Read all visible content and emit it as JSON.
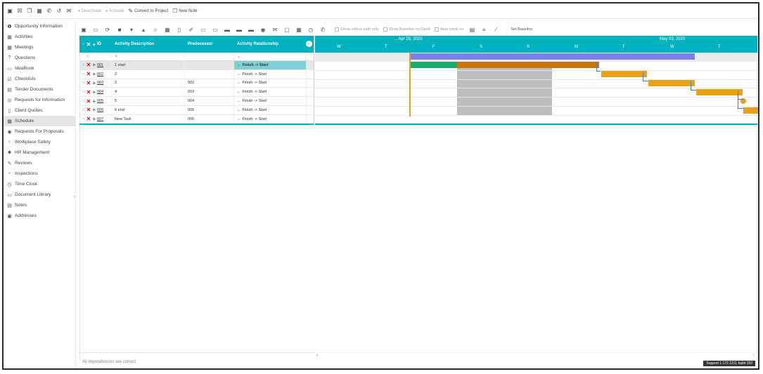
{
  "toolbar": {
    "deactivate_label": "Deactivate",
    "activate_label": "Activate",
    "convert_label": "Convert to Project",
    "new_note_label": "New Note"
  },
  "sidebar": {
    "items": [
      {
        "label": "Opportunity Information",
        "icon": "info-icon"
      },
      {
        "label": "Activities",
        "icon": "calendar-icon"
      },
      {
        "label": "Meetings",
        "icon": "calendar-icon"
      },
      {
        "label": "Questions",
        "icon": "question-icon"
      },
      {
        "label": "IdeaBook",
        "icon": "book-icon"
      },
      {
        "label": "Checklists",
        "icon": "checklist-icon"
      },
      {
        "label": "Tender Documents",
        "icon": "document-icon"
      },
      {
        "label": "Requests for Information",
        "icon": "rfi-icon"
      },
      {
        "label": "Client Quotes",
        "icon": "quote-icon"
      },
      {
        "label": "Schedule",
        "icon": "schedule-icon"
      },
      {
        "label": "Requests For Proposals",
        "icon": "rfp-icon"
      },
      {
        "label": "Workplace Safety",
        "icon": "safety-icon"
      },
      {
        "label": "HR Management",
        "icon": "people-icon"
      },
      {
        "label": "Reviews",
        "icon": "review-icon"
      },
      {
        "label": "Inspections",
        "icon": "pin-icon"
      },
      {
        "label": "Time Clock",
        "icon": "clock-icon"
      },
      {
        "label": "Document Library",
        "icon": "folder-icon"
      },
      {
        "label": "Notes",
        "icon": "notes-icon"
      },
      {
        "label": "Addresses",
        "icon": "address-icon"
      }
    ],
    "active_index": 9
  },
  "grid_toolbar": {
    "show_critical": "Show critical path only",
    "show_baseline": "Show Baseline on Gantt",
    "auto_email": "Auto email on",
    "set_baseline": "Set Baseline"
  },
  "grid": {
    "headers": {
      "id": "ID",
      "description": "Activity Description",
      "predecessor": "Predecessor",
      "relationship": "Activity Relationship"
    },
    "filter_clear": "×",
    "rows": [
      {
        "id": "001",
        "description": "1 start",
        "predecessor": "",
        "relationship": "Finish -> Start"
      },
      {
        "id": "002",
        "description": "2",
        "predecessor": "",
        "relationship": "Finish -> Start"
      },
      {
        "id": "003",
        "description": "3",
        "predecessor": "002",
        "relationship": "Finish -> Start"
      },
      {
        "id": "004",
        "description": "4",
        "predecessor": "003",
        "relationship": "Finish -> Start"
      },
      {
        "id": "005",
        "description": "5",
        "predecessor": "004",
        "relationship": "Finish -> Start"
      },
      {
        "id": "006",
        "description": "6 end",
        "predecessor": "005",
        "relationship": "Finish -> Start"
      },
      {
        "id": "007",
        "description": "New Task",
        "predecessor": "006",
        "relationship": "Finish -> Start"
      }
    ]
  },
  "gantt": {
    "week1_label": "... Apr 26, 2020",
    "week2_label": "May 03, 2020",
    "days": [
      "W",
      "T",
      "F",
      "S",
      "S",
      "M",
      "T",
      "W",
      "T"
    ],
    "colors": {
      "summary": "#7b7fe8",
      "progress": "#1aaa6e",
      "task": "#e8a11a",
      "task_dark": "#c9750d",
      "header": "#00b2c0"
    }
  },
  "status": {
    "message": "All dependencies are correct",
    "build": "Support 1.172.13.0, build 150"
  }
}
